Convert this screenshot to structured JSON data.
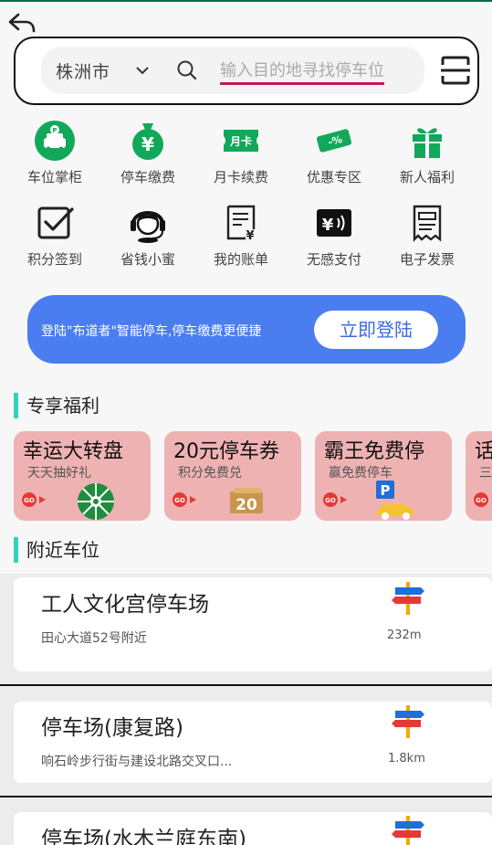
{
  "search": {
    "city": "株洲市",
    "placeholder": "输入目的地寻找停车位"
  },
  "grid_items": [
    {
      "label": "车位掌柜",
      "icon": "parking-car-icon"
    },
    {
      "label": "停车缴费",
      "icon": "money-bag-icon"
    },
    {
      "label": "月卡续费",
      "icon": "monthly-card-icon"
    },
    {
      "label": "优惠专区",
      "icon": "coupon-icon"
    },
    {
      "label": "新人福利",
      "icon": "gift-icon"
    },
    {
      "label": "积分签到",
      "icon": "checkin-icon"
    },
    {
      "label": "省钱小蜜",
      "icon": "headset-icon"
    },
    {
      "label": "我的账单",
      "icon": "bill-icon"
    },
    {
      "label": "无感支付",
      "icon": "contactless-pay-icon"
    },
    {
      "label": "电子发票",
      "icon": "invoice-icon"
    }
  ],
  "banner": {
    "text": "登陆\"布道者\"智能停车,停车缴费更便捷",
    "button": "立即登陆"
  },
  "benefits": {
    "title": "专享福利",
    "cards": [
      {
        "title": "幸运大转盘",
        "subtitle": "天天抽好礼",
        "go": "GO"
      },
      {
        "title": "20元停车券",
        "subtitle": "积分免费兑",
        "go": "GO",
        "art_text": "20"
      },
      {
        "title": "霸王免费停",
        "subtitle": "赢免费停车",
        "go": "GO",
        "art_text": "P"
      },
      {
        "title": "话",
        "subtitle": "三",
        "go": "GO"
      }
    ]
  },
  "nearby": {
    "title": "附近车位",
    "items": [
      {
        "name": "工人文化宫停车场",
        "address": "田心大道52号附近",
        "distance": "232m"
      },
      {
        "name": "停车场(康复路)",
        "address": "响石岭步行街与建设北路交叉口...",
        "distance": "1.8km"
      },
      {
        "name": "停车场(水木兰庭东南)",
        "address": "",
        "distance": ""
      }
    ]
  },
  "colors": {
    "accent_green": "#12a85a",
    "banner_blue": "#4a7df0",
    "card_pink": "#efb2b2",
    "section_bar": "#35d0c0"
  }
}
